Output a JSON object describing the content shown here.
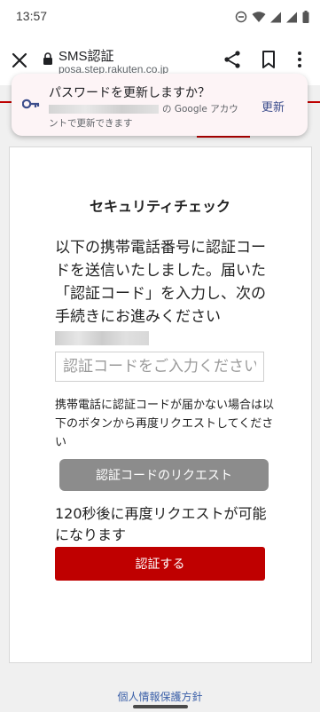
{
  "status_bar": {
    "time": "13:57"
  },
  "toolbar": {
    "title": "SMS認証",
    "url": "posa.step.rakuten.co.jp"
  },
  "password_prompt": {
    "title": "パスワードを更新しますか？",
    "subtitle_line1": "の Google アカウ",
    "subtitle_line2": "ントで更新できます",
    "update_label": "更新"
  },
  "page": {
    "heading": "セキュリティチェック",
    "message": "以下の携帯電話番号に認証コードを送信いたしました。届いた「認証コード」を入力し、次の手続きにお進みください",
    "code_input_placeholder": "認証コードをご入力ください",
    "notice": "携帯電話に認証コードが届かない場合は以下のボタンから再度リクエストしてください",
    "request_button_label": "認証コードのリクエスト",
    "wait_message": "120秒後に再度リクエストが可能になります",
    "verify_button_label": "認証する"
  },
  "footer": {
    "privacy_link": "個人情報保護方針"
  },
  "colors": {
    "brand_red": "#bf0000",
    "disabled_gray": "#8c8c8c",
    "link_blue": "#3a5fa8"
  }
}
